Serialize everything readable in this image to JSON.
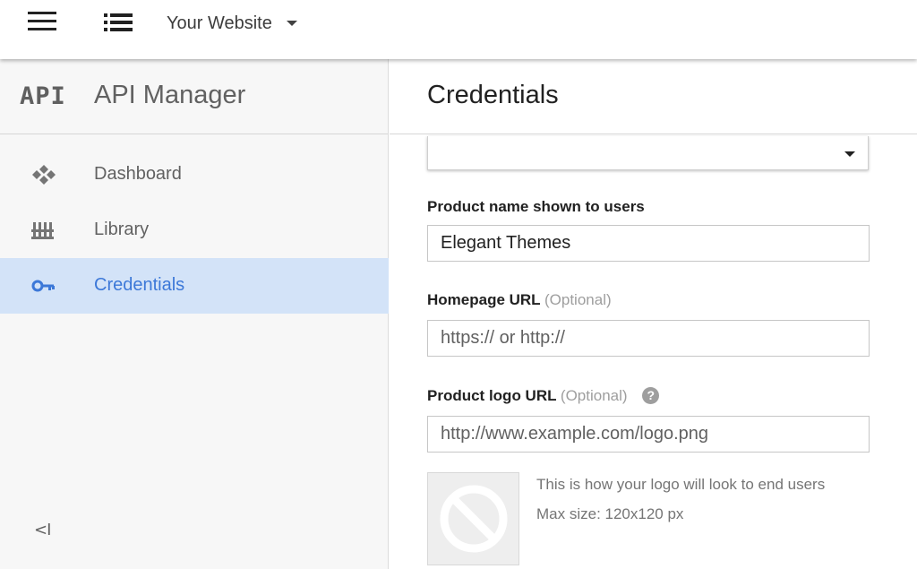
{
  "topbar": {
    "project_name": "Your Website"
  },
  "sidebar": {
    "logo_text": "API",
    "title": "API Manager",
    "items": [
      {
        "label": "Dashboard",
        "icon": "dashboard-icon",
        "active": false
      },
      {
        "label": "Library",
        "icon": "library-icon",
        "active": false
      },
      {
        "label": "Credentials",
        "icon": "key-icon",
        "active": true
      }
    ],
    "collapse_label": "<I"
  },
  "main": {
    "title": "Credentials",
    "fields": {
      "product_name": {
        "label": "Product name shown to users",
        "value": "Elegant Themes"
      },
      "homepage_url": {
        "label": "Homepage URL",
        "optional": "(Optional)",
        "placeholder": "https:// or http://"
      },
      "logo_url": {
        "label": "Product logo URL",
        "optional": "(Optional)",
        "placeholder": "http://www.example.com/logo.png"
      }
    },
    "logo_hint": {
      "line1": "This is how your logo will look to end users",
      "line2": "Max size: 120x120 px"
    }
  },
  "colors": {
    "accent": "#3c78d8",
    "active_bg": "#d3e3f8",
    "sidebar_bg": "#f7f7f7"
  }
}
